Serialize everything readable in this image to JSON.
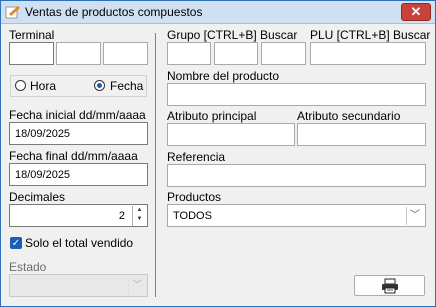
{
  "window": {
    "title": "Ventas de productos compuestos",
    "close_glyph": "✕"
  },
  "left": {
    "terminal_label": "Terminal",
    "terminal_values": [
      "",
      "",
      ""
    ],
    "radio_hora_label": "Hora",
    "radio_fecha_label": "Fecha",
    "selected_radio": "Fecha",
    "fecha_inicial_label": "Fecha inicial dd/mm/aaaa",
    "fecha_inicial_value": "18/09/2025",
    "fecha_final_label": "Fecha final dd/mm/aaaa",
    "fecha_final_value": "18/09/2025",
    "decimales_label": "Decimales",
    "decimales_value": "2",
    "solo_total_label": "Solo el total vendido",
    "solo_total_checked": true,
    "estado_label": "Estado",
    "estado_value": ""
  },
  "right": {
    "grupo_label": "Grupo [CTRL+B] Buscar",
    "grupo_values": [
      "",
      "",
      ""
    ],
    "plu_label": "PLU [CTRL+B] Buscar",
    "plu_value": "",
    "nombre_label": "Nombre del producto",
    "nombre_value": "",
    "atributo_principal_label": "Atributo principal",
    "atributo_principal_value": "",
    "atributo_secundario_label": "Atributo secundario",
    "atributo_secundario_value": "",
    "referencia_label": "Referencia",
    "referencia_value": "",
    "productos_label": "Productos",
    "productos_value": "TODOS"
  },
  "icons": {
    "title_icon": "report-app-icon",
    "print_icon": "printer-icon",
    "dropdown_icon": "chevron-down-icon",
    "spin_icons": [
      "spin-up-icon",
      "spin-down-icon"
    ]
  },
  "colors": {
    "accent": "#1a5fb4",
    "titlebar": "#cfe0f3",
    "close": "#c9423a"
  }
}
